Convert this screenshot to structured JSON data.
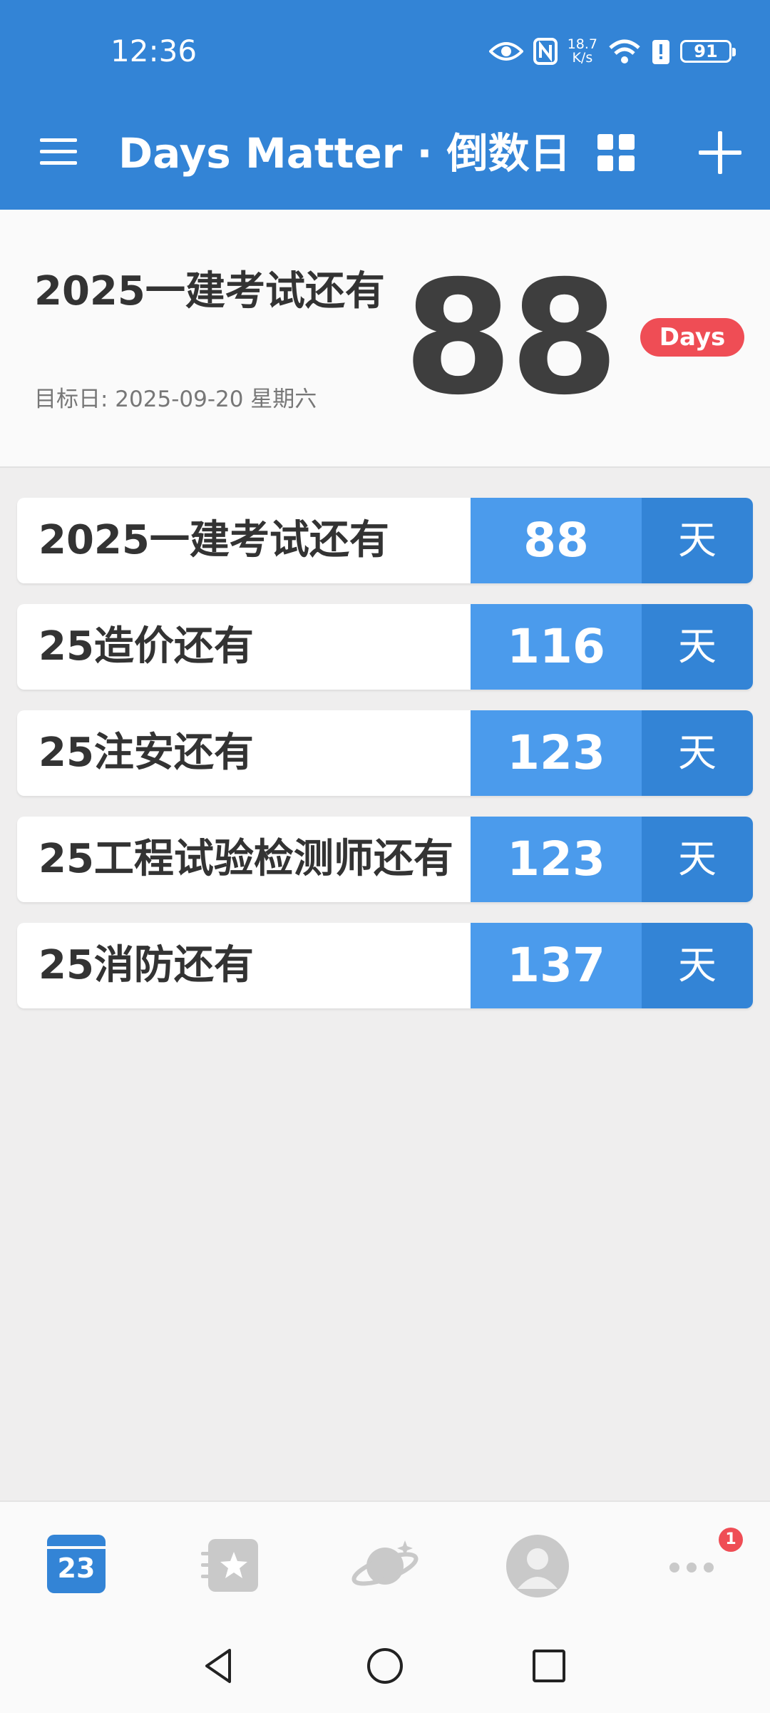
{
  "status_bar": {
    "time": "12:36",
    "net_speed_value": "18.7",
    "net_speed_unit": "K/s",
    "battery": "91"
  },
  "app_bar": {
    "title": "Days Matter · 倒数日"
  },
  "hero": {
    "title": "2025一建考试还有",
    "target_date": "目标日: 2025-09-20 星期六",
    "count": "88",
    "badge": "Days"
  },
  "events": [
    {
      "name": "2025一建考试还有",
      "count": "88",
      "unit": "天"
    },
    {
      "name": "25造价还有",
      "count": "116",
      "unit": "天"
    },
    {
      "name": "25注安还有",
      "count": "123",
      "unit": "天"
    },
    {
      "name": "25工程试验检测师还有",
      "count": "123",
      "unit": "天"
    },
    {
      "name": "25消防还有",
      "count": "137",
      "unit": "天"
    }
  ],
  "bottom_nav": {
    "calendar_day": "23",
    "items": [
      "calendar-icon",
      "favorites-icon",
      "explore-planet-icon",
      "profile-icon",
      "more-icon"
    ],
    "more_badge": "1"
  },
  "colors": {
    "primary": "#3384d6",
    "count_cell": "#4b9bec",
    "badge_red": "#ef4d55"
  }
}
